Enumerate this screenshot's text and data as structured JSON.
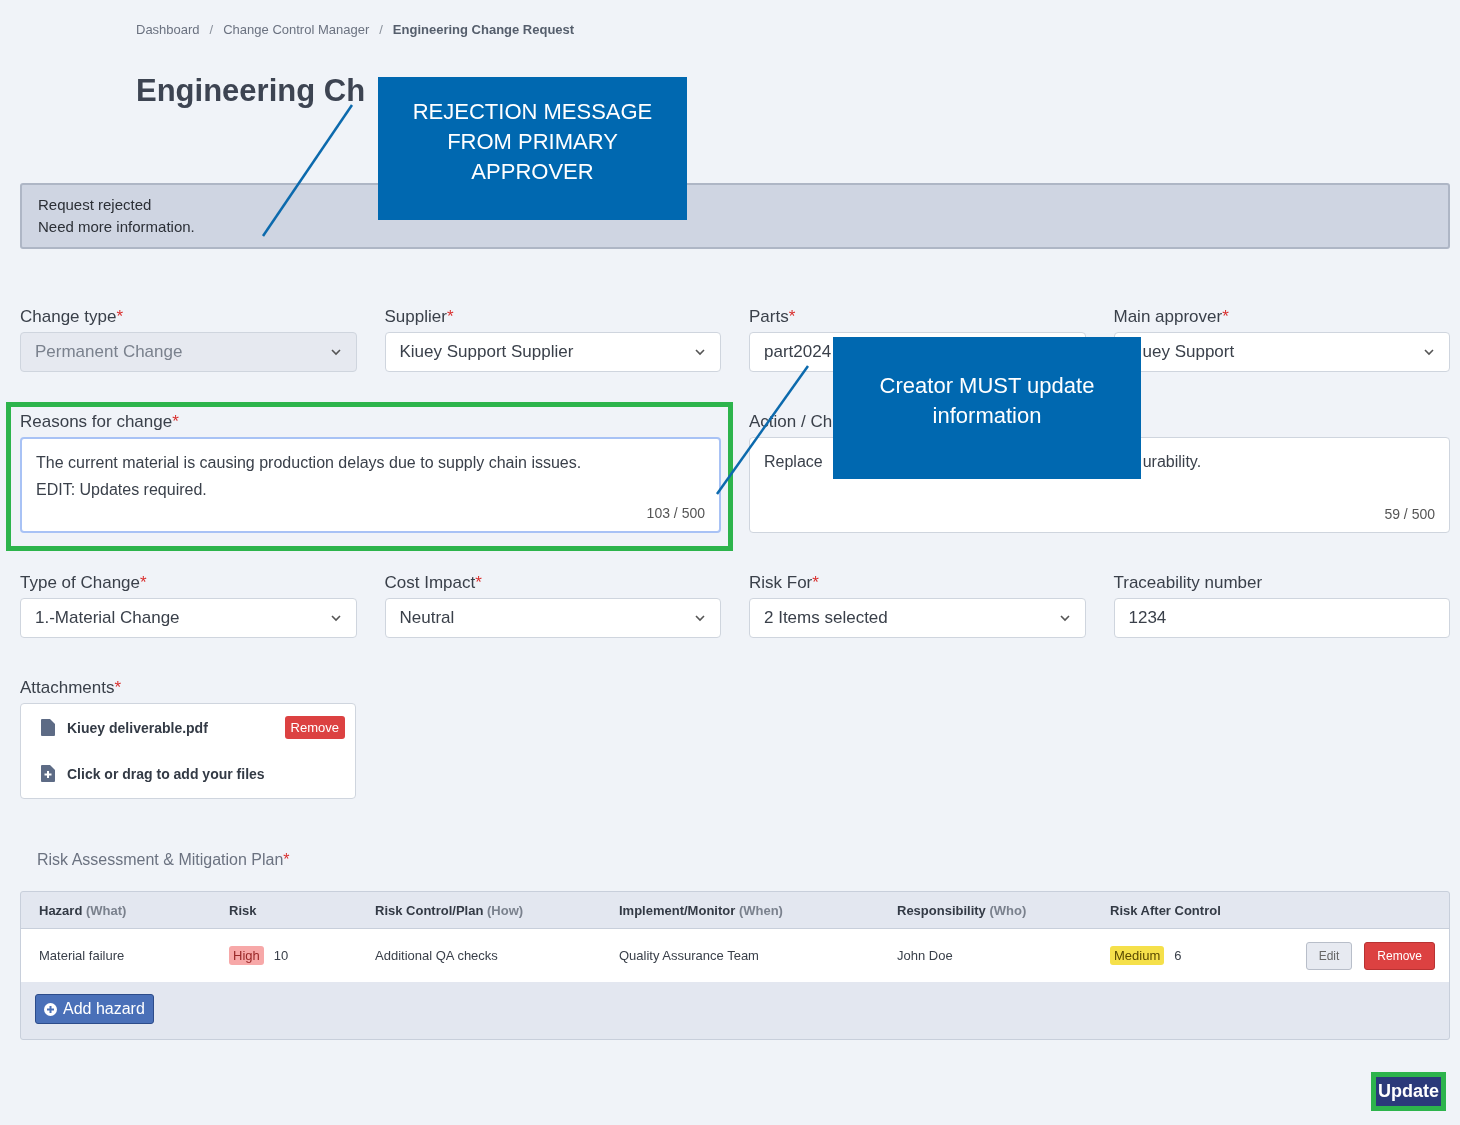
{
  "breadcrumb": [
    {
      "label": "Dashboard",
      "current": false
    },
    {
      "separator": "/",
      "label": "Change Control Manager",
      "current": false
    },
    {
      "separator": "/",
      "label": "Engineering Change Request",
      "current": true
    }
  ],
  "page_title": "Engineering Ch",
  "alert": {
    "title": "Request rejected",
    "message": "Need more information."
  },
  "fields": [
    {
      "kind": "select",
      "label": "Change type",
      "required_mark": "*",
      "value": "Permanent Change",
      "disabled": true
    },
    {
      "kind": "select",
      "label": "Supplier",
      "required_mark": "*",
      "value": "Kiuey Support Supplier",
      "disabled": false
    },
    {
      "kind": "text",
      "label": "Parts",
      "required_mark": "*",
      "value": "part2024",
      "disabled": false
    },
    {
      "kind": "select",
      "label": "Main approver",
      "required_mark": "*",
      "value": "uey Support",
      "disabled": false,
      "clipped_start": true
    },
    {
      "kind": "textarea",
      "label": "Reasons for change",
      "required_mark": "*",
      "value": "The current material is causing production delays due to supply chain issues.\nEDIT: Updates required.",
      "counter": "103 / 500",
      "focused": true,
      "highlighted": true
    },
    {
      "kind": "textarea",
      "label": "Action / Ch",
      "value_parts": [
        "Replace",
        "urability."
      ],
      "counter": "59 / 500",
      "focused": false
    },
    {
      "kind": "select",
      "label": "Type of Change",
      "required_mark": "*",
      "value": "1.-Material Change",
      "disabled": false
    },
    {
      "kind": "select",
      "label": "Cost Impact",
      "required_mark": "*",
      "value": "Neutral",
      "disabled": false
    },
    {
      "kind": "select",
      "label": "Risk For",
      "required_mark": "*",
      "value": "2 Items selected",
      "disabled": false
    },
    {
      "kind": "text",
      "label": "Traceability number",
      "value": "1234",
      "disabled": false
    }
  ],
  "attachments": {
    "label": "Attachments",
    "required_mark": "*",
    "files": [
      {
        "name": "Kiuey deliverable.pdf",
        "action": "Remove"
      }
    ],
    "add_prompt": "Click or drag to add your files"
  },
  "risk_plan": {
    "title": "Risk Assessment & Mitigation Plan",
    "required_mark": "*",
    "columns": [
      {
        "label": "Hazard",
        "hint": "(What)"
      },
      {
        "label": "Risk"
      },
      {
        "label": "Risk Control/Plan",
        "hint": "(How)"
      },
      {
        "label": "Implement/Monitor",
        "hint": "(When)"
      },
      {
        "label": "Responsibility",
        "hint": "(Who)"
      },
      {
        "label": "Risk After Control"
      }
    ],
    "rows": [
      {
        "hazard": "Material failure",
        "risk": {
          "level": "High",
          "score": "10",
          "color": "#f7a8a8"
        },
        "control": "Additional QA checks",
        "monitor": "Quality Assurance Team",
        "responsibility": "John Doe",
        "risk_after": {
          "level": "Medium",
          "score": "6",
          "color": "#f5e04a"
        },
        "actions": [
          {
            "kind": "edit",
            "label": "Edit"
          },
          {
            "kind": "remove",
            "label": "Remove"
          }
        ]
      }
    ],
    "add_button": "Add hazard"
  },
  "submit": {
    "label": "Update",
    "highlighted": true
  },
  "callouts": [
    {
      "text": "REJECTION MESSAGE FROM PRIMARY APPROVER"
    },
    {
      "text": "Creator MUST update information"
    }
  ]
}
